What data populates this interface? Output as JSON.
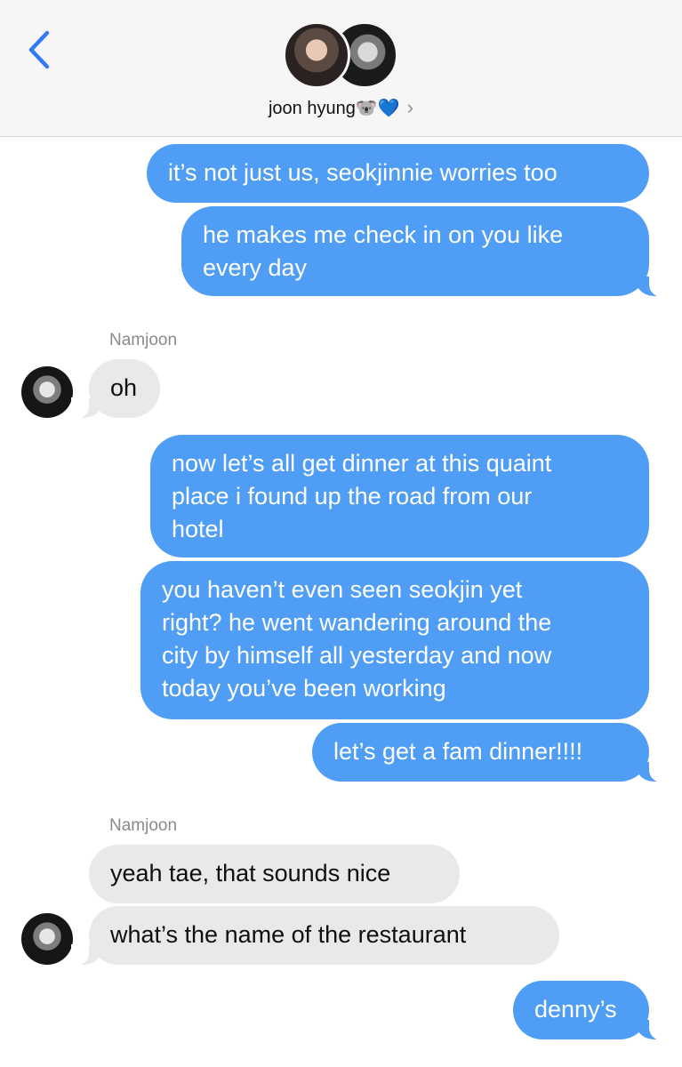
{
  "header": {
    "contact_name": "joon hyung",
    "contact_emoji": "🐨💙",
    "chevron": "›",
    "icons": {
      "back": "chevron-left-icon",
      "detail": "chevron-right-icon"
    }
  },
  "colors": {
    "sent_bubble": "#4f9df4",
    "received_bubble": "#e9e9eb",
    "accent": "#3478f6"
  },
  "messages": [
    {
      "from": "me",
      "text": "it’s not just us, seokjinnie worries too"
    },
    {
      "from": "me",
      "lines": [
        "he makes me check in on you like",
        "every day"
      ]
    },
    {
      "from": "Namjoon",
      "sender_label": "Namjoon",
      "text": "oh"
    },
    {
      "from": "me",
      "lines": [
        "now let’s all get dinner at this quaint",
        "place i found up the road from our",
        "hotel"
      ]
    },
    {
      "from": "me",
      "lines": [
        "you haven’t even seen seokjin yet",
        "right? he went wandering around the",
        "city by himself all yesterday and now",
        "today you’ve been working"
      ]
    },
    {
      "from": "me",
      "text": "let’s get a fam dinner!!!!"
    },
    {
      "from": "Namjoon",
      "sender_label": "Namjoon",
      "text": "yeah tae, that sounds nice"
    },
    {
      "from": "Namjoon",
      "text": "what’s the name of the restaurant"
    },
    {
      "from": "me",
      "text": "denny’s"
    }
  ]
}
